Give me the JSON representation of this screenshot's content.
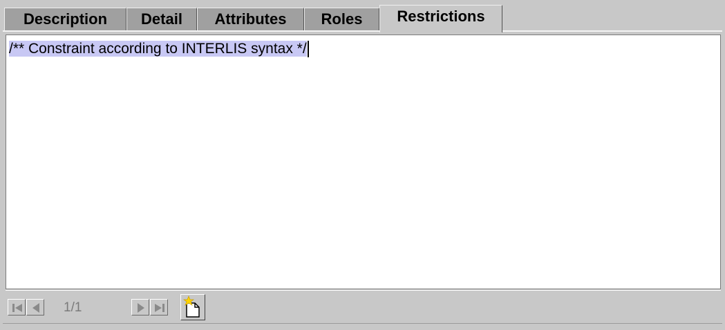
{
  "tabs": [
    {
      "label": "Description",
      "active": false
    },
    {
      "label": "Detail",
      "active": false
    },
    {
      "label": "Attributes",
      "active": false
    },
    {
      "label": "Roles",
      "active": false
    },
    {
      "label": "Restrictions",
      "active": true
    }
  ],
  "editor": {
    "text": "/** Constraint according to INTERLIS syntax */"
  },
  "navigator": {
    "page_indicator": "1/1",
    "icons": [
      "first-icon",
      "prev-icon",
      "next-icon",
      "last-icon",
      "new-document-icon"
    ]
  },
  "colors": {
    "selection": "#c8c8f4",
    "background": "#c8c8c8",
    "inactive_tab": "#a0a0a0"
  }
}
